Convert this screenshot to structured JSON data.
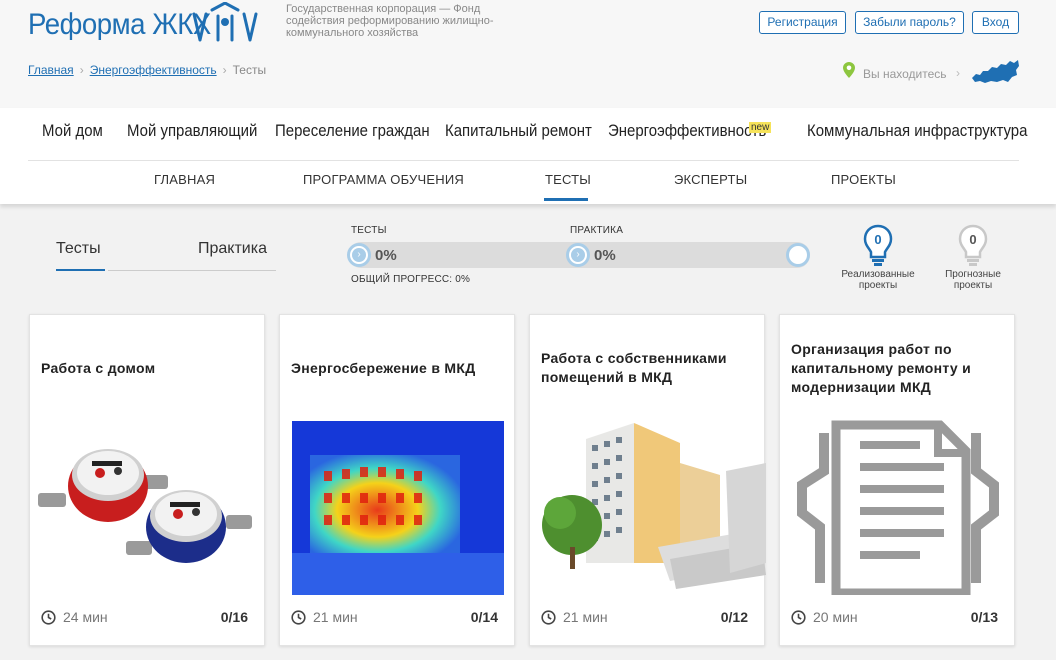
{
  "header": {
    "logo_text": "Реформа ЖКХ",
    "org_name": "Государственная корпорация — Фонд содействия реформированию жилищно-коммунального хозяйства",
    "register_label": "Регистрация",
    "forgot_label": "Забыли пароль?",
    "login_label": "Вход",
    "location_label": "Вы находитесь",
    "accent_color": "#1f6fb3"
  },
  "breadcrumb": {
    "home": "Главная",
    "section": "Энергоэффективность",
    "current": "Тесты"
  },
  "main_nav": {
    "items": [
      "Мой дом",
      "Мой управляющий",
      "Переселение граждан",
      "Капитальный ремонт",
      "Энергоэффективность",
      "Коммунальная инфраструктура"
    ],
    "new_badge": "new"
  },
  "sub_nav": {
    "items": [
      "ГЛАВНАЯ",
      "ПРОГРАММА ОБУЧЕНИЯ",
      "ТЕСТЫ",
      "ЭКСПЕРТЫ",
      "ПРОЕКТЫ"
    ],
    "active": "ТЕСТЫ"
  },
  "tabs": {
    "tests": "Тесты",
    "practice": "Практика",
    "active": "Тесты"
  },
  "progress": {
    "tests_label": "ТЕСТЫ",
    "tests_value": "0%",
    "practice_label": "ПРАКТИКА",
    "practice_value": "0%",
    "total_label": "ОБЩИЙ ПРОГРЕСС: 0%",
    "arrow": "›"
  },
  "projects": {
    "implemented_count": "0",
    "implemented_label_1": "Реализованные",
    "implemented_label_2": "проекты",
    "forecast_count": "0",
    "forecast_label_1": "Прогнозные",
    "forecast_label_2": "проекты"
  },
  "cards": [
    {
      "title": "Работа с домом",
      "time": "24 мин",
      "count": "0/16",
      "image": "water-meters"
    },
    {
      "title": "Энергосбережение в МКД",
      "time": "21 мин",
      "count": "0/14",
      "image": "thermal-building"
    },
    {
      "title": "Работа с собственниками помещений в МКД",
      "time": "21 мин",
      "count": "0/12",
      "image": "building-documents"
    },
    {
      "title": "Организация работ по капитальному ремонту и модернизации МКД",
      "time": "20 мин",
      "count": "0/13",
      "image": "document-gear"
    }
  ]
}
